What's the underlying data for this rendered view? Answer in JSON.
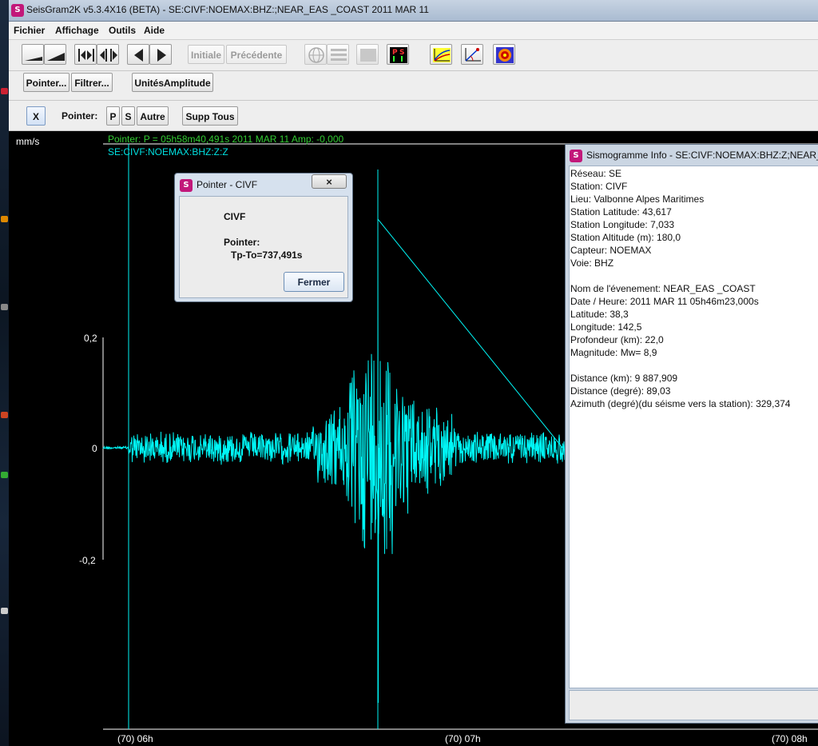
{
  "window": {
    "title": "SeisGram2K v5.3.4X16 (BETA) - SE:CIVF:NOEMAX:BHZ:;NEAR_EAS _COAST 2011 MAR 11",
    "icon": "seisgram-app-icon"
  },
  "menu": [
    {
      "label": "Fichier"
    },
    {
      "label": "Affichage"
    },
    {
      "label": "Outils"
    },
    {
      "label": "Aide"
    }
  ],
  "toolbar1": {
    "icon_buttons_left": [
      "amplitude-decrease-icon",
      "amplitude-increase-icon",
      "zoom-in-time-icon",
      "zoom-out-time-icon",
      "scroll-left-icon",
      "scroll-right-icon"
    ],
    "initiale_label": "Initiale",
    "precedente_label": "Précédente",
    "icon_buttons_right": [
      "globe-map-icon",
      "list-view-icon",
      "blank-window-icon",
      "ps-phase-icon",
      "travel-time-plot-icon",
      "polar-plot-icon",
      "spectrogram-icon"
    ]
  },
  "toolbar2": {
    "pointer_label": "Pointer...",
    "filter_label": "Filtrer...",
    "units_label": "UnitésAmplitude"
  },
  "toolbar3": {
    "x_label": "X",
    "pointer_caption": "Pointer:",
    "p_label": "P",
    "s_label": "S",
    "autre_label": "Autre",
    "supp_label": "Supp Tous"
  },
  "plot": {
    "units": "mm/s",
    "pointer_status": "Pointer: P =  05h58m40,491s  2011 MAR 11  Amp: -0,000",
    "trace_label": "SE:CIVF:NOEMAX:BHZ:Z:Z",
    "y_ticks": [
      "0,2",
      "0",
      "-0,2"
    ],
    "x_ticks": [
      "(70) 06h",
      "(70) 07h",
      "(70) 08h"
    ],
    "trace_color": "#00f5f5",
    "status_color": "#33cc33"
  },
  "pointer_dialog": {
    "title": "Pointer - CIVF",
    "station": "CIVF",
    "pointer_label": "Pointer:",
    "value": "Tp-To=737,491s",
    "close_label": "Fermer",
    "close_glyph": "×"
  },
  "info_panel": {
    "title": "Sismogramme Info - SE:CIVF:NOEMAX:BHZ:Z;NEAR_EAS _COAST",
    "lines": [
      "Réseau: SE",
      "Station: CIVF",
      "Lieu: Valbonne Alpes Maritimes",
      "Station Latitude: 43,617",
      "Station Longitude: 7,033",
      "Station Altitude (m): 180,0",
      "Capteur: NOEMAX",
      "Voie: BHZ",
      "",
      "Nom de l'évenement: NEAR_EAS _COAST",
      "Date / Heure: 2011 MAR 11  05h46m23,000s",
      "Latitude: 38,3",
      "Longitude: 142,5",
      "Profondeur (km): 22,0",
      "Magnitude: Mw= 8,9",
      "",
      "Distance (km): 9 887,909",
      "Distance (degré): 89,03",
      "Azimuth (degré)(du séisme vers la station): 329,374"
    ]
  }
}
